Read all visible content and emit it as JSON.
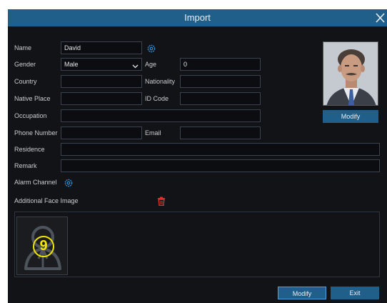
{
  "dialog": {
    "title": "Import",
    "close_icon": "close-icon"
  },
  "form": {
    "name_label": "Name",
    "name_value": "David",
    "gender_label": "Gender",
    "gender_value": "Male",
    "age_label": "Age",
    "age_value": "0",
    "country_label": "Country",
    "country_value": "",
    "nationality_label": "Nationality",
    "nationality_value": "",
    "native_place_label": "Native Place",
    "native_place_value": "",
    "id_code_label": "ID Code",
    "id_code_value": "",
    "occupation_label": "Occupation",
    "occupation_value": "",
    "phone_label": "Phone Number",
    "phone_value": "",
    "email_label": "Email",
    "email_value": "",
    "residence_label": "Residence",
    "residence_value": "",
    "remark_label": "Remark",
    "remark_value": "",
    "alarm_channel_label": "Alarm Channel",
    "additional_face_label": "Additional Face Image"
  },
  "photo": {
    "modify_label": "Modify"
  },
  "face": {
    "badge_number": "9"
  },
  "footer": {
    "modify_label": "Modify",
    "exit_label": "Exit"
  },
  "colors": {
    "accent": "#1f5f8a",
    "background": "#111317",
    "delete_icon": "#d9342b",
    "badge": "#f2e600"
  }
}
